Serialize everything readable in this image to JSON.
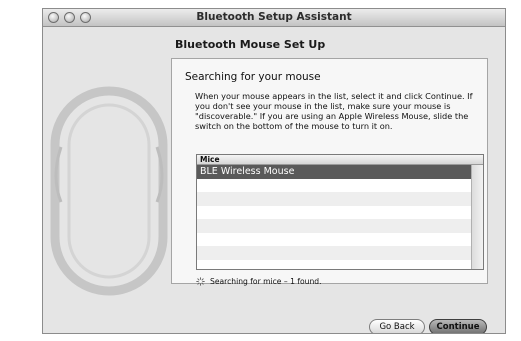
{
  "window": {
    "title": "Bluetooth Setup Assistant"
  },
  "heading": "Bluetooth Mouse Set Up",
  "panel": {
    "subheading": "Searching for your mouse",
    "instructions": "When your mouse appears in the list, select it and click Continue. If you don't see your mouse in the list, make sure your mouse is \"discoverable.\" If you are using an Apple Wireless Mouse, slide the switch on the bottom of the mouse to turn it on.",
    "list": {
      "header": "Mice",
      "items": [
        "BLE Wireless Mouse"
      ],
      "selected": "BLE Wireless Mouse"
    },
    "status": "Searching for mice – 1 found."
  },
  "buttons": {
    "back": "Go Back",
    "continue": "Continue"
  },
  "icons": {
    "spinner": "spinner-icon",
    "mouse": "mouse-illustration"
  }
}
